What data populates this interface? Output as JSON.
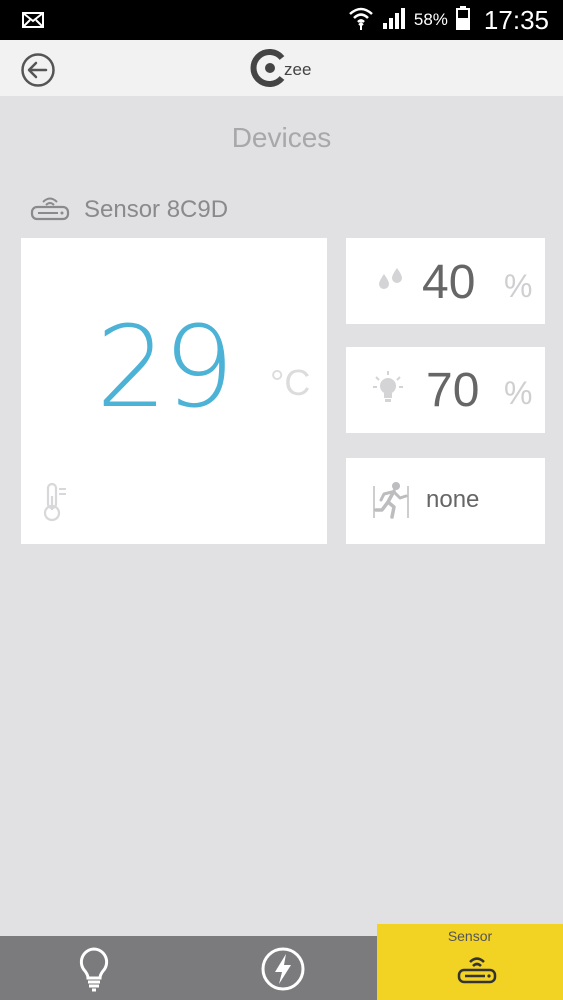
{
  "status_bar": {
    "battery_percent": "58%",
    "time": "17:35"
  },
  "header": {
    "logo_text": "zee"
  },
  "page_title": "Devices",
  "device": {
    "name": "Sensor 8C9D"
  },
  "temperature": {
    "value": "29",
    "unit": "°C"
  },
  "humidity": {
    "value": "40",
    "unit": "%"
  },
  "light": {
    "value": "70",
    "unit": "%"
  },
  "motion": {
    "value": "none"
  },
  "bottom_nav": {
    "active_label": "Sensor",
    "active_color": "#f2d223"
  },
  "colors": {
    "accent_temperature": "#4cb2d6",
    "background": "#e1e1e3"
  }
}
